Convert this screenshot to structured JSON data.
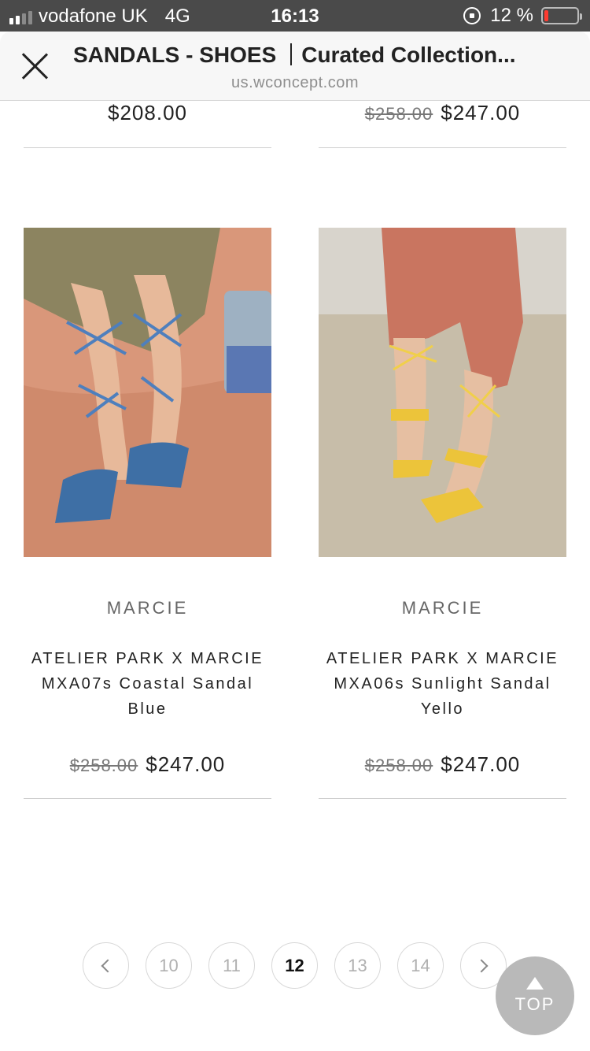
{
  "status_bar": {
    "carrier": "vodafone UK",
    "network": "4G",
    "time": "16:13",
    "battery_percent": "12 %",
    "battery_level": 0.12
  },
  "browser": {
    "title_main": "SANDALS - SHOES",
    "title_sub": "Curated Collection...",
    "url": "us.wconcept.com"
  },
  "top_row": [
    {
      "price": "$208.00",
      "old_price": ""
    },
    {
      "price": "$247.00",
      "old_price": "$258.00"
    }
  ],
  "products": [
    {
      "brand": "MARCIE",
      "name_line1": "ATELIER PARK X MARCIE",
      "name_line2": "MXA07s Coastal Sandal",
      "name_line3": "Blue",
      "old_price": "$258.00",
      "price": "$247.00",
      "image": "blue-lace-up-sandals-photo"
    },
    {
      "brand": "MARCIE",
      "name_line1": "ATELIER PARK X MARCIE",
      "name_line2": "MXA06s Sunlight Sandal",
      "name_line3": "Yello",
      "old_price": "$258.00",
      "price": "$247.00",
      "image": "yellow-lace-up-sandals-photo"
    }
  ],
  "pagination": {
    "prev_icon": "chevron-left-icon",
    "pages": [
      "10",
      "11",
      "12",
      "13",
      "14"
    ],
    "current": "12",
    "next_icon": "chevron-right-icon"
  },
  "top_button": {
    "label": "TOP"
  }
}
